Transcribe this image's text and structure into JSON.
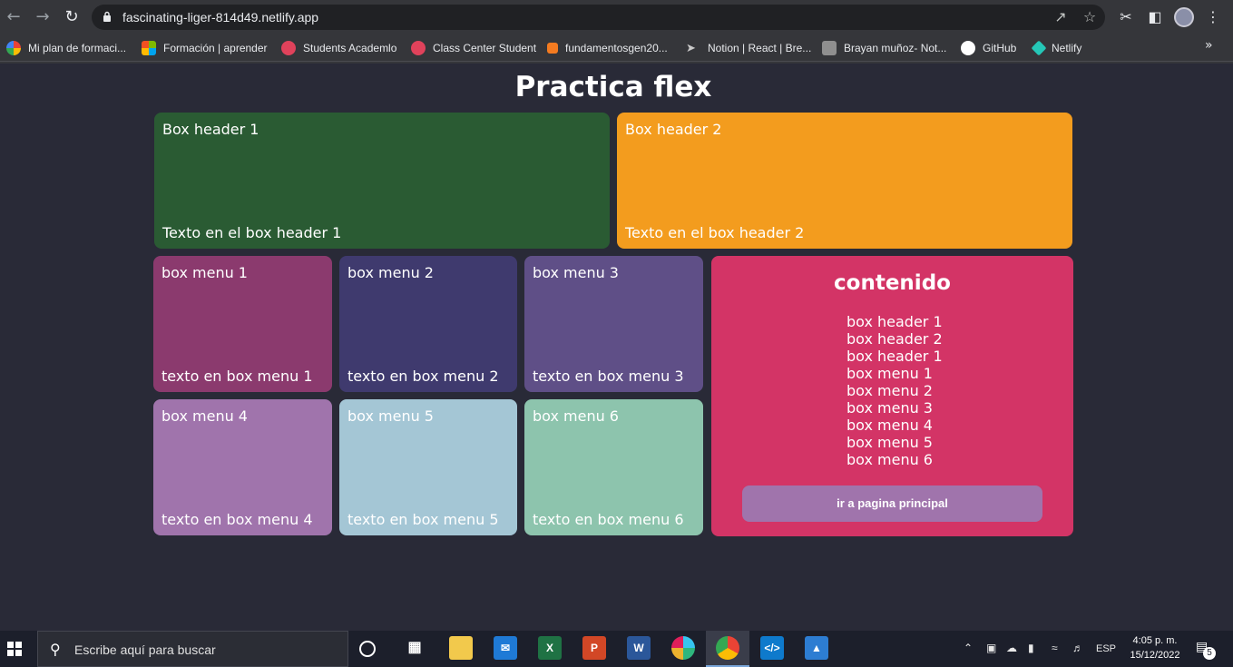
{
  "browser": {
    "url": "fascinating-liger-814d49.netlify.app",
    "bookmarks": [
      {
        "label": "Mi plan de formaci...",
        "icon": "google-icon",
        "color": "#ffffff"
      },
      {
        "label": "Formación | aprender",
        "icon": "microsoft-icon",
        "color": "#f25022"
      },
      {
        "label": "Students Academlo",
        "icon": "academlo-icon",
        "color": "#e0425b"
      },
      {
        "label": "Class Center Student",
        "icon": "academlo-icon",
        "color": "#e0425b"
      },
      {
        "label": "fundamentosgen20...",
        "icon": "orange-blocks-icon",
        "color": "#f47b20"
      },
      {
        "label": "Notion | React | Bre...",
        "icon": "rocket-icon",
        "color": "#c9c9c9"
      },
      {
        "label": "Brayan muñoz- Not...",
        "icon": "avatar-icon",
        "color": "#9a9a9a"
      },
      {
        "label": "GitHub",
        "icon": "github-icon",
        "color": "#ffffff"
      },
      {
        "label": "Netlify",
        "icon": "netlify-icon",
        "color": "#25c7b7"
      }
    ]
  },
  "page": {
    "title": "Practica flex",
    "headers": [
      {
        "heading": "Box header 1",
        "text": "Texto en el box header 1",
        "color": "#2a5b33"
      },
      {
        "heading": "Box header 2",
        "text": "Texto en el box header 2",
        "color": "#f39c1e"
      }
    ],
    "menus": [
      {
        "heading": "box menu 1",
        "text": "texto en box menu 1",
        "color": "#8b3a6e"
      },
      {
        "heading": "box menu 2",
        "text": "texto en box menu 2",
        "color": "#3f3a6e"
      },
      {
        "heading": "box menu 3",
        "text": "texto en box menu 3",
        "color": "#5f4f87"
      },
      {
        "heading": "box menu 4",
        "text": "texto en box menu 4",
        "color": "#a074ac"
      },
      {
        "heading": "box menu 5",
        "text": "texto en box menu 5",
        "color": "#a4c6d5"
      },
      {
        "heading": "box menu 6",
        "text": "texto en box menu 6",
        "color": "#8dc4ad"
      }
    ],
    "content": {
      "title": "contenido",
      "links": [
        "box header 1",
        "box header 2",
        "box header 1",
        "box menu 1",
        "box menu 2",
        "box menu 3",
        "box menu 4",
        "box menu 5",
        "box menu 6"
      ],
      "button_label": "ir a pagina principal",
      "color": "#d33466"
    }
  },
  "taskbar": {
    "search_placeholder": "Escribe aquí para buscar",
    "language": "ESP",
    "time": "4:05 p. m.",
    "date": "15/12/2022",
    "notification_count": "5"
  }
}
